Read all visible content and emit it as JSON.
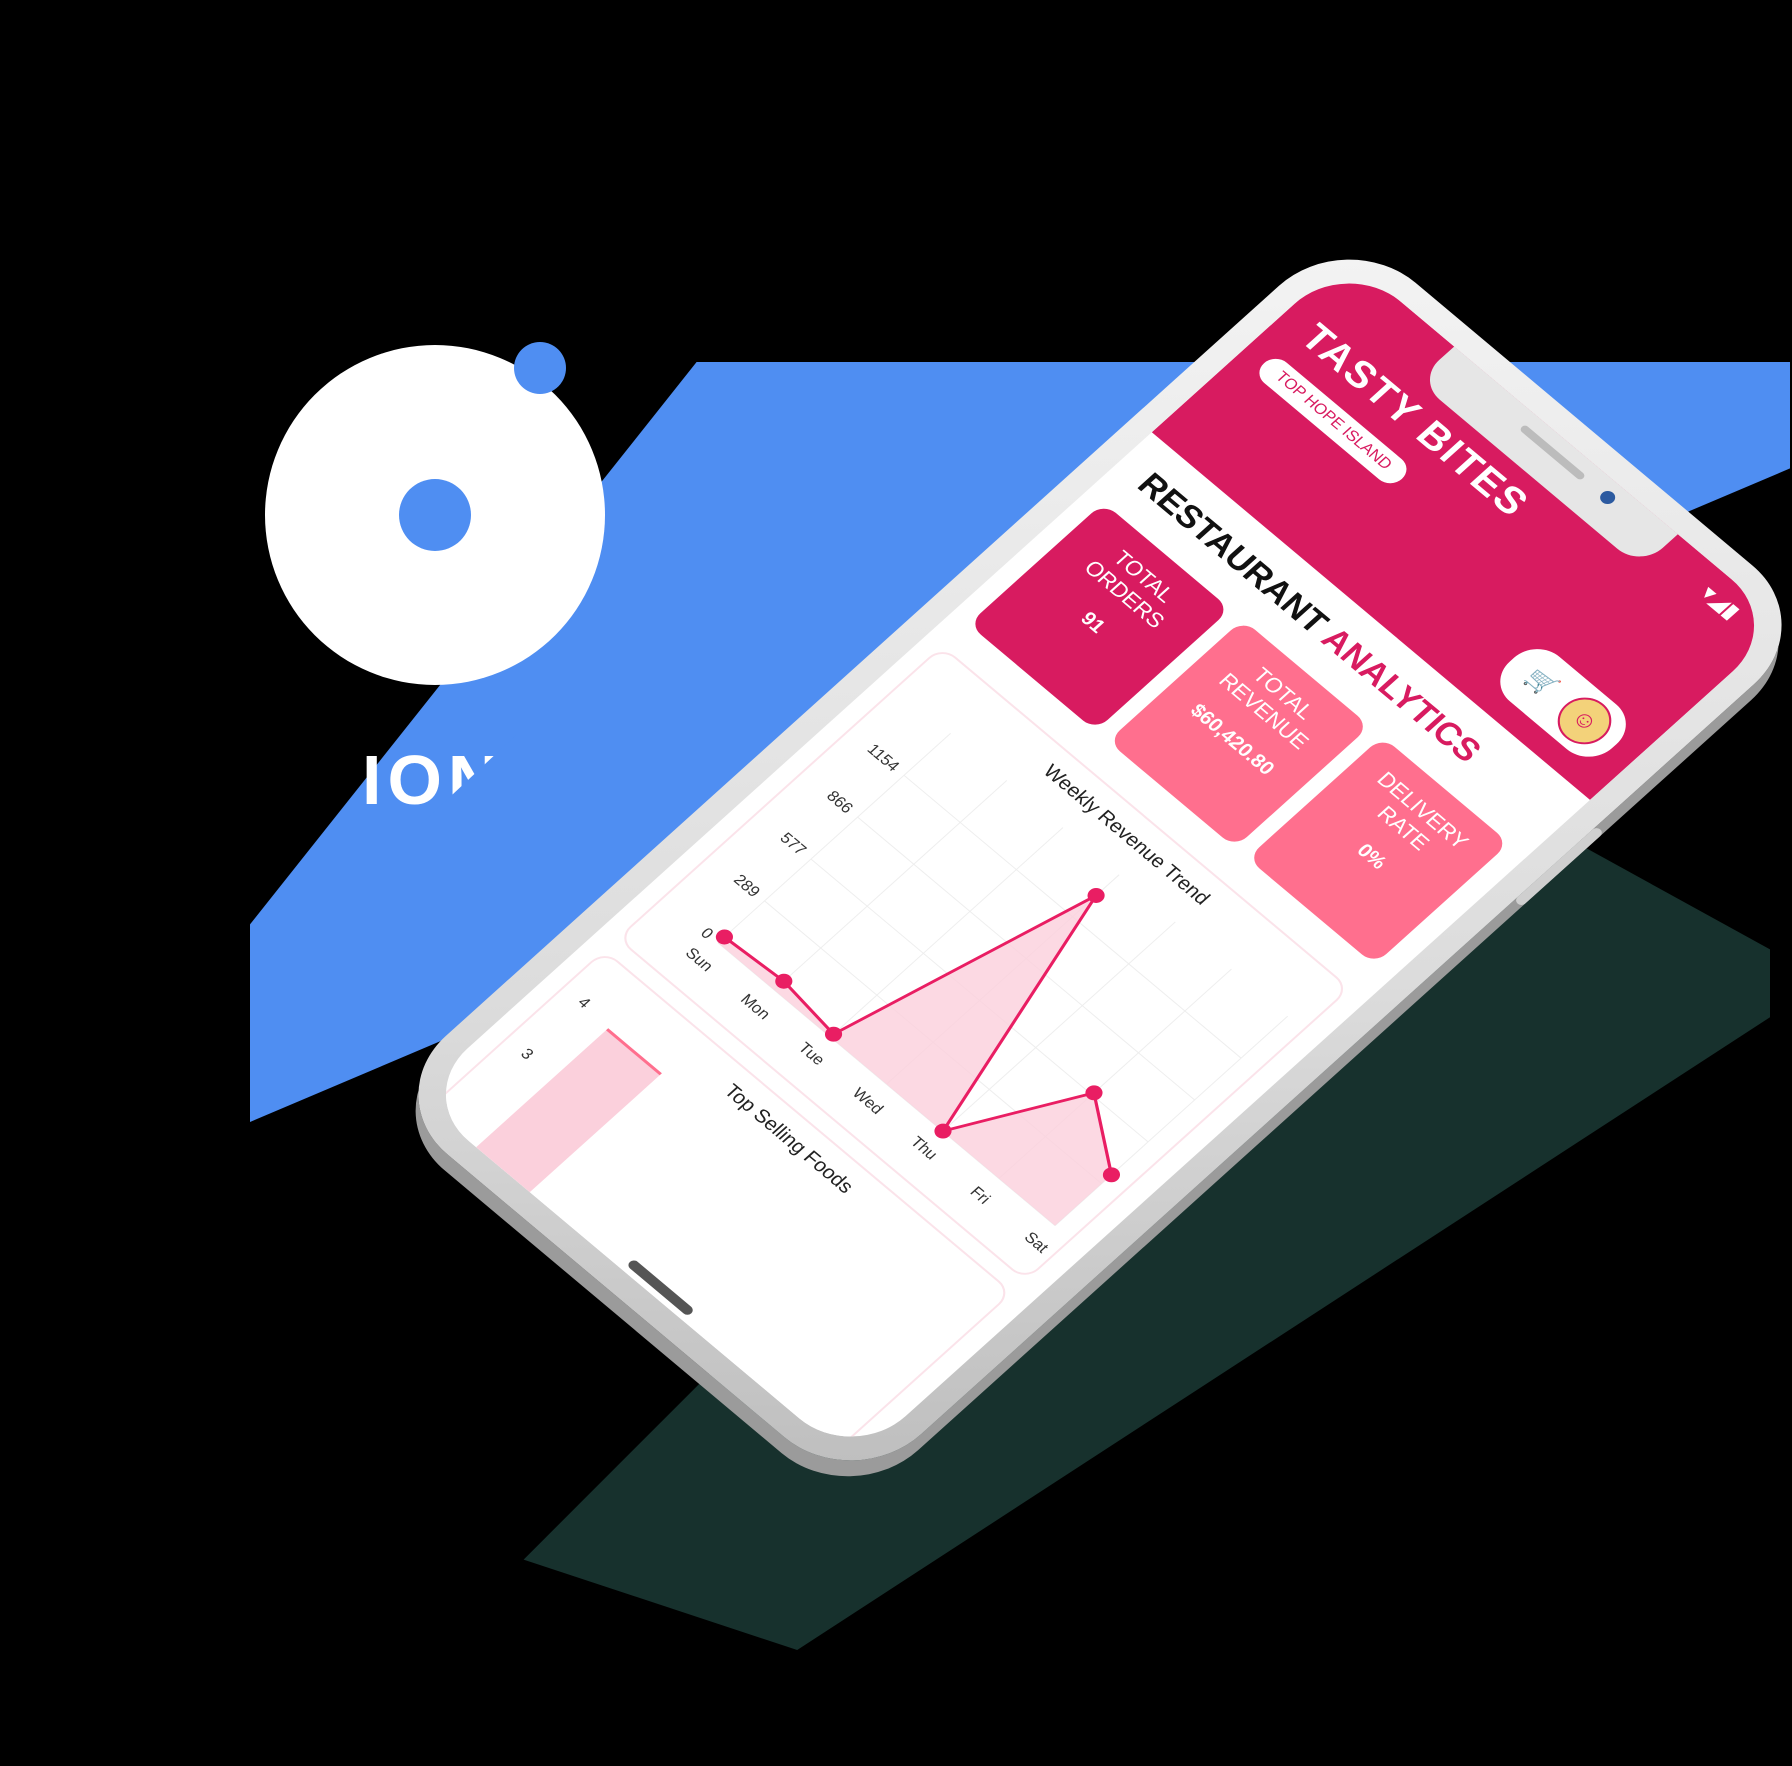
{
  "brand": {
    "logo_word": "IONIC",
    "logo_color": "#4f8ef2"
  },
  "app": {
    "title": "TASTY BITES",
    "branch_label": "TOP HOPE ISLAND",
    "status_icons": "▾◢▮",
    "cart_icon": "cart-icon",
    "avatar_icon": "avatar"
  },
  "heading": {
    "primary": "RESTAURANT",
    "accent": "ANALYTICS"
  },
  "stats": [
    {
      "label": "TOTAL ORDERS",
      "value": "91"
    },
    {
      "label": "TOTAL REVENUE",
      "value": "$60,420.80"
    },
    {
      "label": "DELIVERY RATE",
      "value": "0%"
    }
  ],
  "chart_data": {
    "type": "area",
    "title": "Weekly Revenue Trend",
    "categories": [
      "Sun",
      "Mon",
      "Tue",
      "Wed",
      "Thu",
      "Fri",
      "Sat"
    ],
    "values": [
      40,
      60,
      20,
      1300,
      2,
      590,
      350
    ],
    "yticks": [
      "0",
      "289",
      "577",
      "866",
      "1154"
    ],
    "ylim": [
      0,
      1443
    ],
    "grid": true,
    "color": "#e91e63",
    "fill_color": "#fbd0dc"
  },
  "top_selling": {
    "title": "Top Selling Foods",
    "yticks": [
      "3",
      "4"
    ]
  },
  "colors": {
    "primary": "#d81b60",
    "secondary": "#ff6f8e"
  }
}
